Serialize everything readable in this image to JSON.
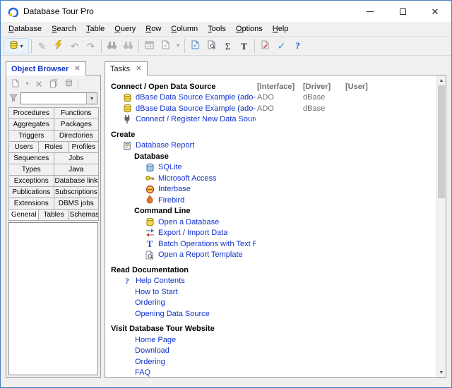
{
  "colors": {
    "link": "#1030cc",
    "window_border": "#4a7ebc",
    "muted_text": "#6e6e6e",
    "tab_selected_text": "#1433c8"
  },
  "icons": {
    "close": "✕",
    "tab_close": "✕",
    "dropdown": "▾",
    "pencil": "✎",
    "undo": "↶",
    "redo": "↷",
    "sigma": "Σ",
    "text_tool": "T",
    "check": "✓",
    "help": "?",
    "batch_t": "T",
    "help_contents": "?",
    "scroll_up": "▲",
    "scroll_down": "▼",
    "delete": "✕"
  },
  "window": {
    "title": "Database Tour Pro"
  },
  "menu": {
    "items": [
      "Database",
      "Search",
      "Table",
      "Query",
      "Row",
      "Column",
      "Tools",
      "Options",
      "Help"
    ]
  },
  "object_browser": {
    "tab_label": "Object Browser",
    "filter_value": "",
    "selected_category": "General",
    "category_rows": [
      [
        "Procedures",
        "Functions"
      ],
      [
        "Aggregates",
        "Packages"
      ],
      [
        "Triggers",
        "Directories"
      ],
      [
        "Users",
        "Roles",
        "Profiles"
      ],
      [
        "Sequences",
        "Jobs"
      ],
      [
        "Types",
        "Java"
      ],
      [
        "Exceptions",
        "Database links"
      ],
      [
        "Publications",
        "Subscriptions"
      ],
      [
        "Extensions",
        "DBMS jobs"
      ],
      [
        "General",
        "Tables",
        "Schemas"
      ]
    ]
  },
  "tasks": {
    "tab_label": "Tasks",
    "connect": {
      "header": "Connect / Open Data Source",
      "columns": [
        "[Interface]",
        "[Driver]",
        "[User]"
      ],
      "items": [
        {
          "label": "dBase Data Source Example (ado-odbc)",
          "interface": "ADO",
          "driver": "dBase",
          "user": ""
        },
        {
          "label": "dBase Data Source Example (ado-directory)",
          "interface": "ADO",
          "driver": "dBase",
          "user": ""
        }
      ],
      "register_link": "Connect / Register New Data Source..."
    },
    "create": {
      "header": "Create",
      "report_link": "Database Report",
      "database": {
        "header": "Database",
        "items": [
          "SQLite",
          "Microsoft Access",
          "Interbase",
          "Firebird"
        ]
      },
      "command_line": {
        "header": "Command Line",
        "items": [
          "Open a Database",
          "Export / Import Data",
          "Batch Operations with Text Fields",
          "Open a Report Template"
        ]
      }
    },
    "documentation": {
      "header": "Read Documentation",
      "items": [
        "Help Contents",
        "How to Start",
        "Ordering",
        "Opening Data Source"
      ]
    },
    "website": {
      "header": "Visit Database Tour Website",
      "items": [
        "Home Page",
        "Download",
        "Ordering",
        "FAQ"
      ]
    }
  }
}
